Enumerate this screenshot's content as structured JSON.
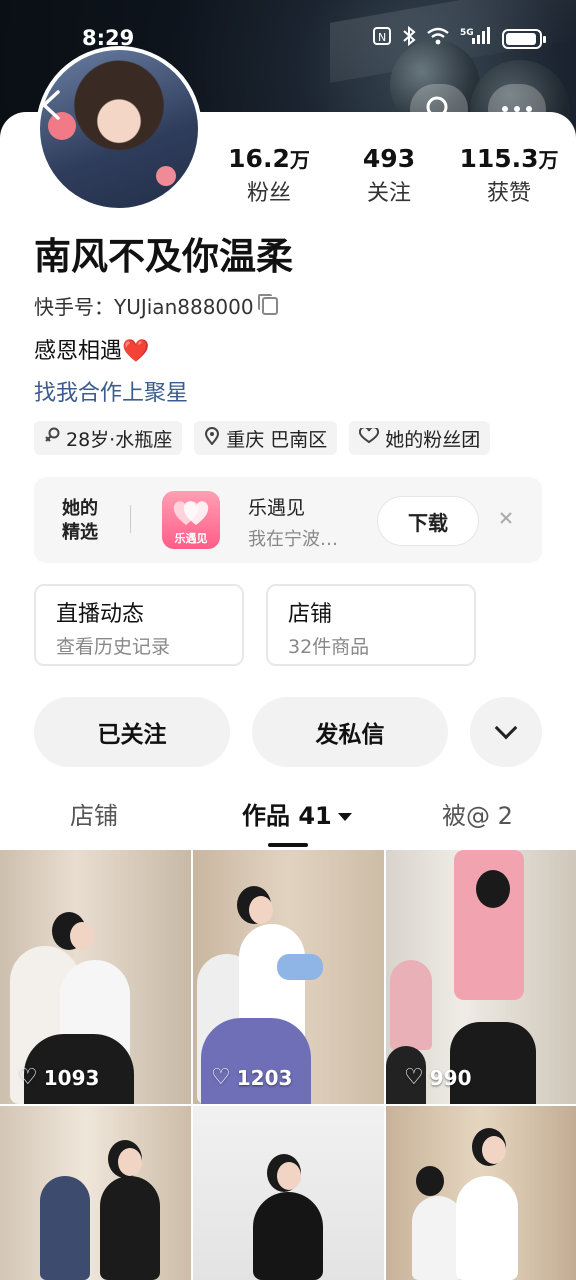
{
  "status_bar": {
    "time": "8:29",
    "icons": [
      "nfc-icon",
      "bluetooth-icon",
      "wifi-icon",
      "5g-signal-icon",
      "battery-icon"
    ],
    "network": "5G"
  },
  "profile": {
    "name": "南风不及你温柔",
    "kuaishou_id": "快手号：YUJian888000",
    "bio": "感恩相遇",
    "bio_emoji": "❤️",
    "collab_link": "找我合作上聚星",
    "stats": [
      {
        "value": "16.2",
        "unit": "万",
        "label": "粉丝"
      },
      {
        "value": "493",
        "unit": "",
        "label": "关注"
      },
      {
        "value": "115.3",
        "unit": "万",
        "label": "获赞"
      }
    ],
    "tags": [
      {
        "icon": "gender-female-icon",
        "text": "28岁·水瓶座"
      },
      {
        "icon": "location-pin-icon",
        "text": "重庆 巴南区"
      },
      {
        "icon": "fan-group-heart-icon",
        "text": "她的粉丝团"
      }
    ]
  },
  "picks": {
    "label_line1": "她的",
    "label_line2": "精选",
    "app_name": "乐遇见",
    "app_icon_text": "乐遇见",
    "app_desc": "我在宁波…",
    "download_label": "下载"
  },
  "mini_cards": {
    "live_title": "直播动态",
    "live_sub": "查看历史记录",
    "shop_title": "店铺",
    "shop_sub": "32件商品"
  },
  "actions": {
    "follow_label": "已关注",
    "message_label": "发私信"
  },
  "tabs": {
    "shop": "店铺",
    "works": "作品 41",
    "mentioned": "被@ 2"
  },
  "videos": [
    {
      "likes": "1093"
    },
    {
      "likes": "1203"
    },
    {
      "likes": "990"
    },
    {
      "likes": ""
    },
    {
      "likes": ""
    },
    {
      "likes": ""
    }
  ],
  "colors": {
    "link": "#3b5c8c",
    "heart": "#e0202a",
    "app_icon": "#ff6f93"
  }
}
